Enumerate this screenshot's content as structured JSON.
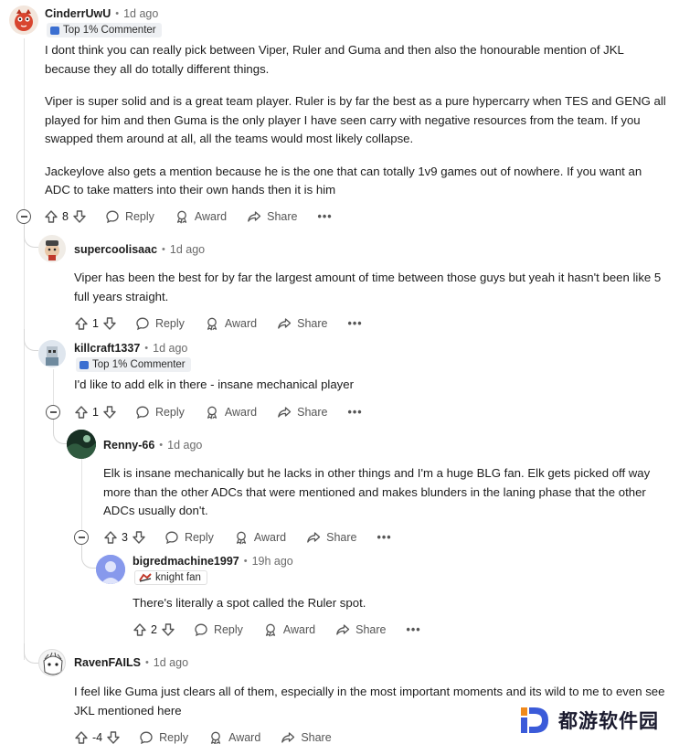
{
  "colors": {
    "accent": "#3b6fd1",
    "thread": "#e3e3e3",
    "muted": "#6b6b6b",
    "logo_orange": "#f08a1c",
    "logo_blue": "#3b5bd9"
  },
  "comments": [
    {
      "username": "CinderrUwU",
      "time": "1d ago",
      "flair": "Top 1% Commenter",
      "paragraphs": [
        "I dont think you can really pick between Viper, Ruler and Guma and then also the honourable mention of JKL because they all do totally different things.",
        "Viper is super solid and is a great team player. Ruler is by far the best as a pure hypercarry when TES and GENG all played for him and then Guma is the only player I have seen carry with negative resources from the team. If you swapped them around at all, all the teams would most likely collapse.",
        "Jackeylove also gets a mention because he is the one that can totally 1v9 games out of nowhere. If you want an ADC to take matters into their own hands then it is him"
      ],
      "votes": "8"
    },
    {
      "username": "supercoolisaac",
      "time": "1d ago",
      "paragraphs": [
        "Viper has been the best for by far the largest amount of time between those guys but yeah it hasn't been like 5 full years straight."
      ],
      "votes": "1"
    },
    {
      "username": "killcraft1337",
      "time": "1d ago",
      "flair": "Top 1% Commenter",
      "paragraphs": [
        "I'd like to add elk in there - insane mechanical player"
      ],
      "votes": "1"
    },
    {
      "username": "Renny-66",
      "time": "1d ago",
      "paragraphs": [
        "Elk is insane mechanically but he lacks in other things and I'm a huge BLG fan. Elk gets picked off way more than the other ADCs that were mentioned and makes blunders in the laning phase that the other ADCs usually don't."
      ],
      "votes": "3"
    },
    {
      "username": "bigredmachine1997",
      "time": "19h ago",
      "flair": "knight fan",
      "paragraphs": [
        "There's literally a spot called the Ruler spot."
      ],
      "votes": "2"
    },
    {
      "username": "RavenFAILS",
      "time": "1d ago",
      "paragraphs": [
        "I feel like Guma just clears all of them, especially in the most important moments and its wild to me to even see JKL mentioned here"
      ],
      "votes": "-4"
    }
  ],
  "actions": {
    "reply": "Reply",
    "award": "Award",
    "share": "Share",
    "more": "•••"
  },
  "meta": {
    "dot": "•"
  },
  "watermark": {
    "text": "都游软件园"
  }
}
